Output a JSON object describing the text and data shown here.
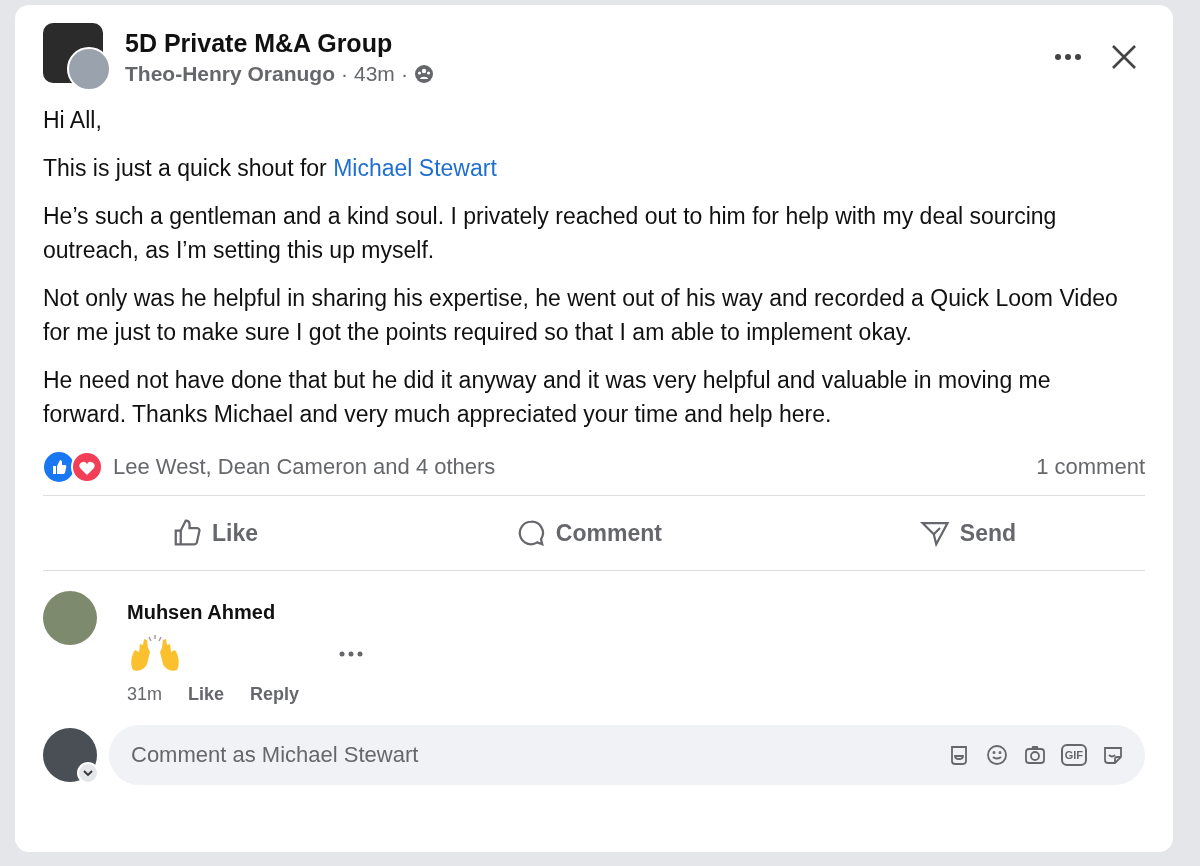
{
  "post": {
    "group": "5D Private M&A Group",
    "author": "Theo-Henry Oranugo",
    "time": "43m",
    "separator": "·",
    "paragraphs": [
      {
        "text": "Hi All,"
      },
      {
        "text": "This is just a quick shout for ",
        "mention": "Michael Stewart"
      },
      {
        "text": "He’s such a gentleman and a kind soul. I privately reached out to him for help with my deal sourcing outreach, as I’m setting this up myself."
      },
      {
        "text": "Not only was he helpful in sharing his expertise, he went out of his way and recorded a Quick Loom Video for me just to make sure I got the points required so that I am able to implement okay."
      },
      {
        "text": "He need not have done that but he did it anyway and it was very helpful and valuable in moving me forward. Thanks Michael and very much appreciated your time and help here."
      }
    ],
    "reactions": "Lee West, Dean Cameron and 4 others",
    "comment_count": "1 comment",
    "actions": [
      {
        "kind": "like",
        "label": "Like"
      },
      {
        "kind": "comment",
        "label": "Comment"
      },
      {
        "kind": "send",
        "label": "Send"
      }
    ]
  },
  "comments": [
    {
      "name": "Muhsen Ahmed",
      "time": "31m",
      "actions": [
        "Like",
        "Reply"
      ]
    }
  ],
  "composer": {
    "placeholder": "Comment as Michael Stewart",
    "gif_label": "GIF"
  }
}
